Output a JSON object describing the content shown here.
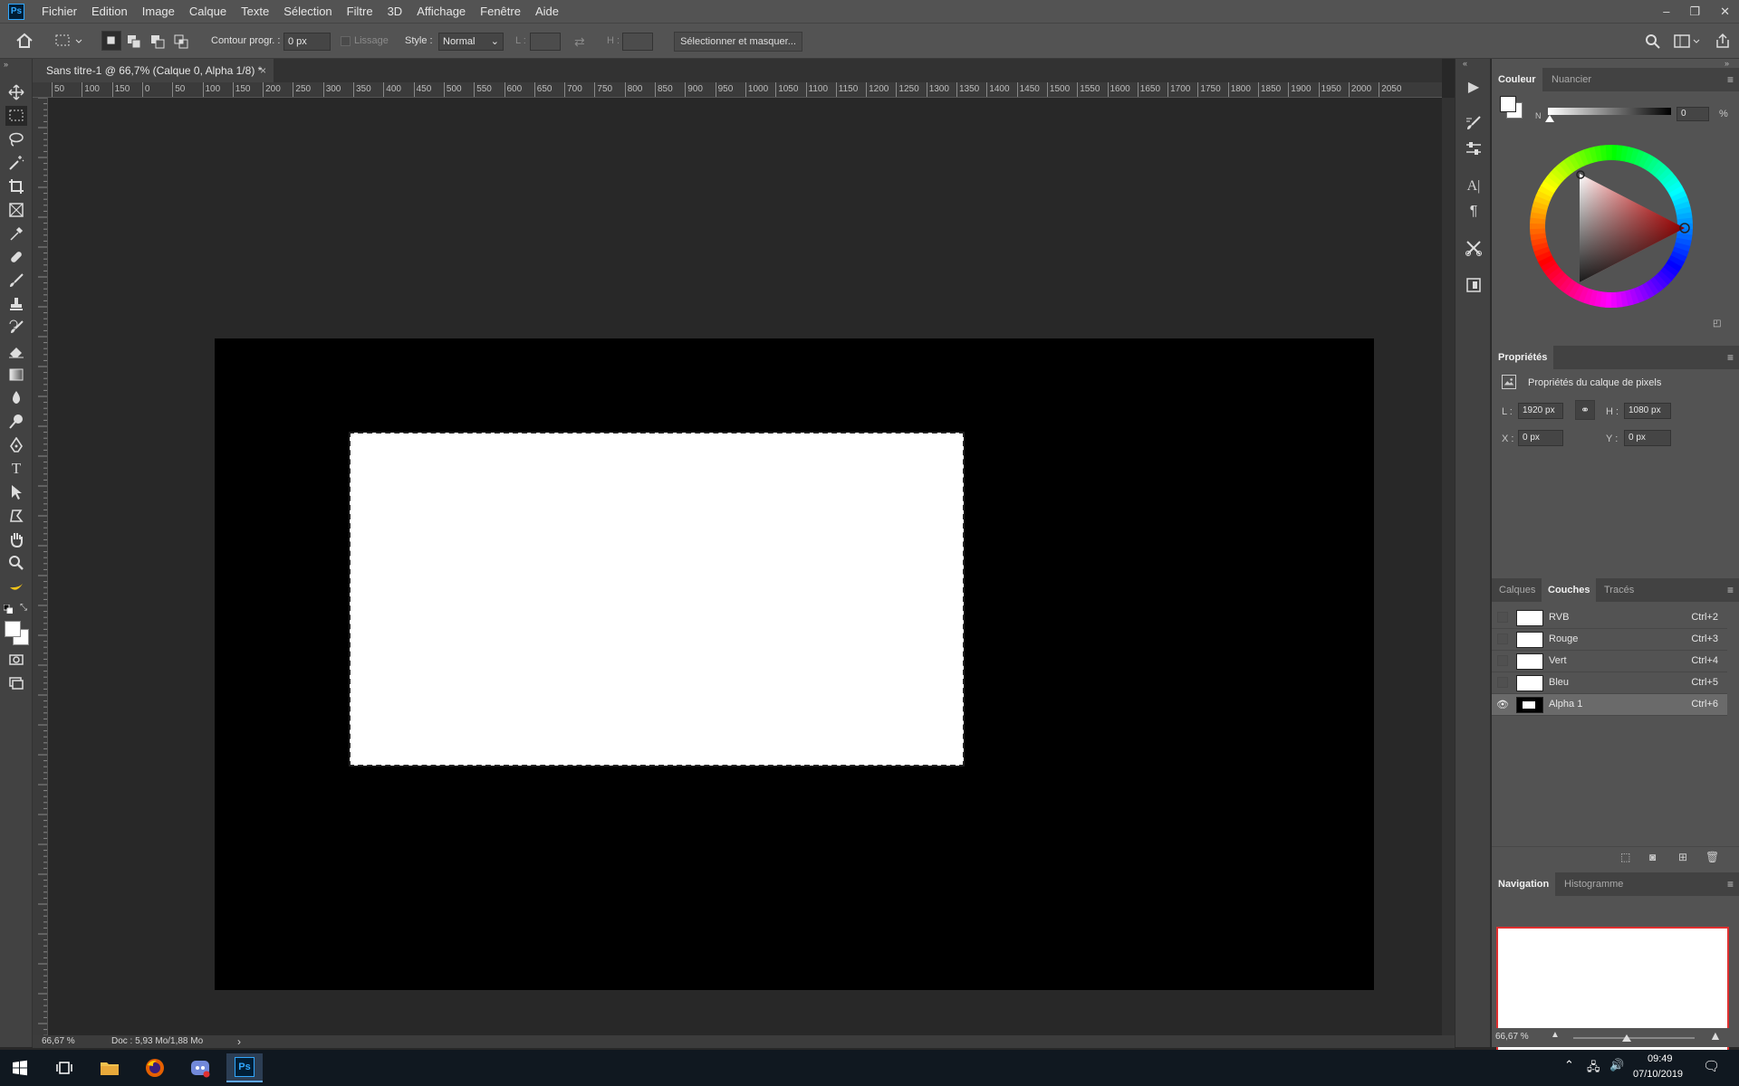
{
  "app": {
    "logo": "Ps"
  },
  "menu": [
    "Fichier",
    "Edition",
    "Image",
    "Calque",
    "Texte",
    "Sélection",
    "Filtre",
    "3D",
    "Affichage",
    "Fenêtre",
    "Aide"
  ],
  "options": {
    "feather_label": "Contour progr. :",
    "feather_value": "0 px",
    "antialias_label": "Lissage",
    "style_label": "Style :",
    "style_value": "Normal",
    "width_label": "L :",
    "height_label": "H :",
    "select_mask_button": "Sélectionner et masquer..."
  },
  "document": {
    "tab_title": "Sans titre-1 @ 66,7% (Calque 0, Alpha 1/8) *",
    "close": "×"
  },
  "rulers": {
    "horizontal": [
      "50",
      "100",
      "150",
      "0",
      "50",
      "100",
      "150",
      "200",
      "250",
      "300",
      "350",
      "400",
      "450",
      "500",
      "550",
      "600",
      "650",
      "700",
      "750",
      "800",
      "850",
      "900",
      "950",
      "1000",
      "1050",
      "1100",
      "1150",
      "1200",
      "1250",
      "1300",
      "1350",
      "1400",
      "1450",
      "1500",
      "1550",
      "1600",
      "1650",
      "1700",
      "1750",
      "1800",
      "1850",
      "1900",
      "1950",
      "2000",
      "2050"
    ]
  },
  "status": {
    "zoom": "66,67 %",
    "doc_info": "Doc : 5,93 Mo/1,88 Mo",
    "arrow": "›"
  },
  "color_panel": {
    "tabs": [
      "Couleur",
      "Nuancier"
    ],
    "slider_label": "N",
    "value": "0",
    "unit": "%"
  },
  "properties_panel": {
    "title": "Propriétés",
    "subtitle": "Propriétés du calque de pixels",
    "w_label": "L :",
    "w_value": "1920 px",
    "h_label": "H :",
    "h_value": "1080 px",
    "x_label": "X :",
    "x_value": "0 px",
    "y_label": "Y :",
    "y_value": "0 px"
  },
  "channels_panel": {
    "tabs": [
      "Calques",
      "Couches",
      "Tracés"
    ],
    "rows": [
      {
        "name": "RVB",
        "shortcut": "Ctrl+2"
      },
      {
        "name": "Rouge",
        "shortcut": "Ctrl+3"
      },
      {
        "name": "Vert",
        "shortcut": "Ctrl+4"
      },
      {
        "name": "Bleu",
        "shortcut": "Ctrl+5"
      },
      {
        "name": "Alpha 1",
        "shortcut": "Ctrl+6"
      }
    ]
  },
  "navigation_panel": {
    "tabs": [
      "Navigation",
      "Histogramme"
    ],
    "zoom": "66,67 %"
  },
  "taskbar": {
    "time": "09:49",
    "date": "07/10/2019"
  },
  "colors": {
    "accent_ps": "#31a8ff",
    "nav_frame": "#e03030"
  }
}
